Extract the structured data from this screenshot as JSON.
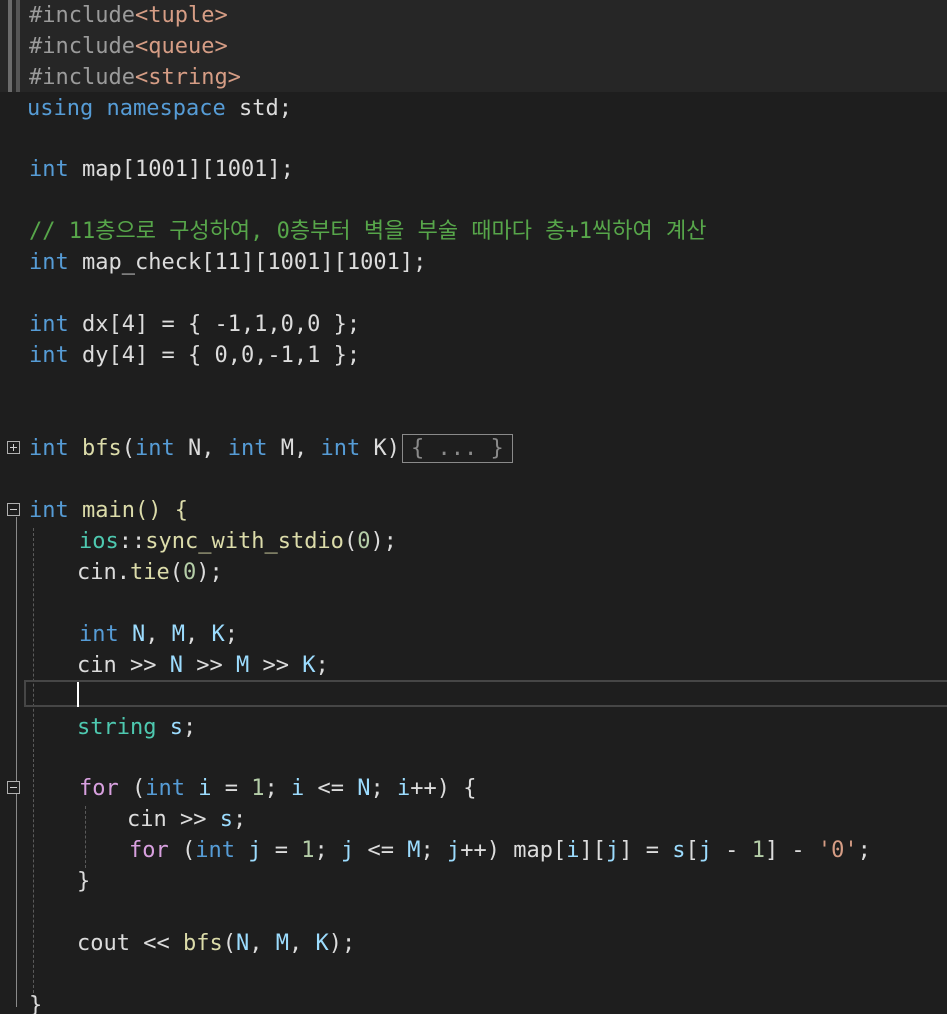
{
  "editor": {
    "collapsed_placeholder": "{ ... }",
    "comment_text": "// 11층으로 구성하여, 0층부터 벽을 부술 때마다 층+1씩하여 계산"
  },
  "code": {
    "include_directive": "#include",
    "include_tuple": "<tuple>",
    "include_queue": "<queue>",
    "include_string": "<string>",
    "using": "using",
    "namespace": "namespace",
    "std": "std;",
    "int": "int",
    "map_decl": "map[1001][1001];",
    "map_check_decl": "map_check[11][1001][1001];",
    "dx_decl": "dx[4] = { -1,1,0,0 };",
    "dy_decl": "dy[4] = { 0,0,-1,1 };",
    "bfs_name": "bfs",
    "bfs_params_open": "(",
    "param_N": "N",
    "param_M": "M",
    "param_K": "K",
    "main_sig": "main() {",
    "ios": "ios",
    "sync": "sync_with_stdio",
    "cin": "cin",
    "tie": "tie",
    "string_kw": "string",
    "s_var": "s",
    "for_kw": "for",
    "cout": "cout",
    "close_brace": "}"
  },
  "colors": {
    "background": "#1e1e1e",
    "keyword": "#569cd6",
    "control": "#d8a0df",
    "type": "#4ec9b0",
    "function": "#dcdcaa",
    "variable": "#9cdcfe",
    "number": "#b5cea8",
    "string": "#d69d85",
    "comment": "#57a64a"
  },
  "icons": {
    "fold_expand": "plus-box-icon",
    "fold_collapse": "minus-box-icon"
  }
}
